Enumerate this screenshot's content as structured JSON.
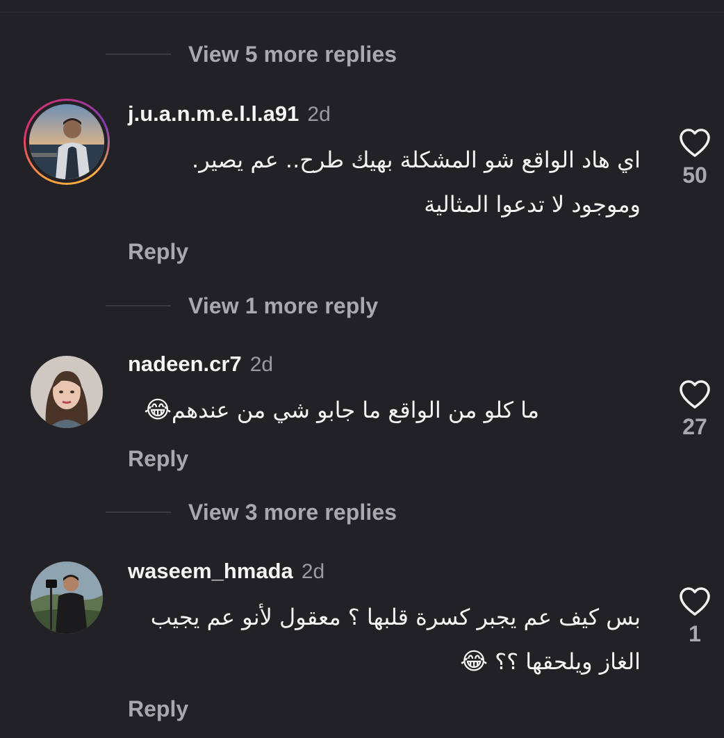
{
  "threads": [
    {
      "view_more_label": "View 5 more replies"
    },
    {
      "username": "j.u.a.n.m.e.l.l.a91",
      "time": "2d",
      "text_lines": [
        "اي هاد الواقع شو المشكلة بهيك طرح.. عم يصير.",
        "وموجود لا تدعوا المثالية"
      ],
      "reply_label": "Reply",
      "likes": "50",
      "avatar_icon": "profile-photo-man-seaside"
    },
    {
      "view_more_label": "View 1 more reply"
    },
    {
      "username": "nadeen.cr7",
      "time": "2d",
      "text_lines": [
        "ما كلو من الواقع ما جابو شي من عندهم"
      ],
      "emoji": "😂",
      "reply_label": "Reply",
      "likes": "27",
      "avatar_icon": "profile-photo-woman"
    },
    {
      "view_more_label": "View 3 more replies"
    },
    {
      "username": "waseem_hmada",
      "time": "2d",
      "text_lines": [
        "بس كيف عم يجبر كسرة قلبها ؟ معقول لأنو عم يجيب",
        "الغاز ويلحقها ؟؟"
      ],
      "emoji": "😂",
      "reply_label": "Reply",
      "likes": "1",
      "avatar_icon": "profile-photo-man-camera"
    }
  ],
  "colors": {
    "background": "#222226",
    "muted_text": "#a8a8ae",
    "primary_text": "#f5f5f5",
    "story_ring": "#e1306c"
  },
  "icons": {
    "like": "heart-outline-icon"
  }
}
